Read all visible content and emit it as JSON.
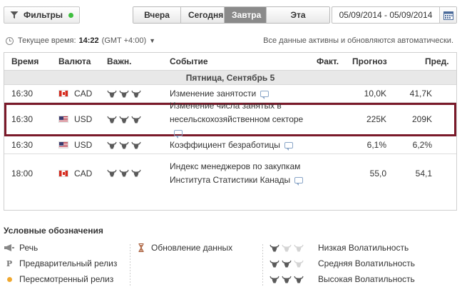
{
  "toolbar": {
    "filter_label": "Фильтры",
    "tabs": [
      "Вчера",
      "Сегодня",
      "Завтра",
      "Эта Неделя"
    ],
    "active_tab": 2,
    "date_range": "05/09/2014 - 05/09/2014"
  },
  "status": {
    "current_time_label": "Текущее время:",
    "current_time": "14:22",
    "timezone": "(GMT +4:00)",
    "auto_note": "Все данные активны и обновляются автоматически."
  },
  "table": {
    "headers": {
      "time": "Время",
      "currency": "Валюта",
      "importance": "Важн.",
      "event": "Событие",
      "actual": "Факт.",
      "forecast": "Прогноз",
      "previous": "Пред."
    },
    "day_label": "Пятница, Сентябрь 5",
    "rows": [
      {
        "time": "16:30",
        "currency": "CAD",
        "flag": "ca",
        "importance": 3,
        "event": "Изменение занятости",
        "actual": "",
        "forecast": "10,0K",
        "previous": "41,7K",
        "highlight": false
      },
      {
        "time": "16:30",
        "currency": "USD",
        "flag": "us",
        "importance": 3,
        "event": "Изменение числа занятых в несельскохозяйственном секторе",
        "actual": "",
        "forecast": "225K",
        "previous": "209K",
        "highlight": true
      },
      {
        "time": "16:30",
        "currency": "USD",
        "flag": "us",
        "importance": 3,
        "event": "Коэффициент безработицы",
        "actual": "",
        "forecast": "6,1%",
        "previous": "6,2%",
        "highlight": false
      },
      {
        "time": "18:00",
        "currency": "CAD",
        "flag": "ca",
        "importance": 3,
        "event": "Индекс менеджеров по закупкам Института Статистики Канады",
        "actual": "",
        "forecast": "55,0",
        "previous": "54,1",
        "highlight": false
      }
    ]
  },
  "legend": {
    "title": "Условные обозначения",
    "speech": "Речь",
    "preliminary": "Предварительный релиз",
    "preliminary_mark": "P",
    "revised": "Пересмотренный релиз",
    "data_update": "Обновление данных",
    "low_vol": "Низкая Волатильность",
    "mid_vol": "Средняя Волатильность",
    "high_vol": "Высокая Волатильность"
  },
  "colors": {
    "highlight_border": "#7a1a2a",
    "active_tab": "#8a8a8a",
    "filter_dot": "#3fbf3f",
    "revised_dot": "#f0a830"
  }
}
